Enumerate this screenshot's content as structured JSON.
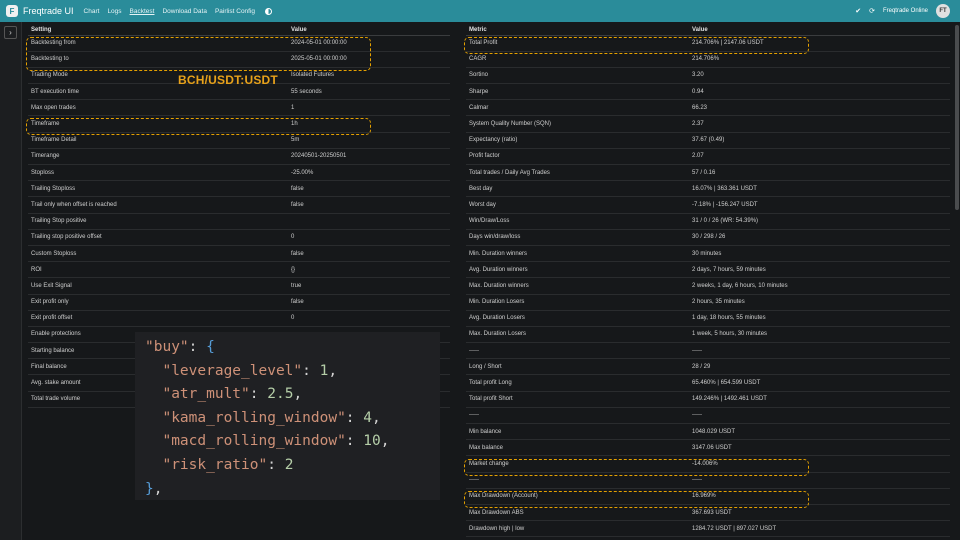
{
  "navbar": {
    "brand": "Freqtrade UI",
    "links": [
      "Chart",
      "Logs",
      "Backtest",
      "Download Data",
      "Pairlist Config"
    ],
    "active_link": "Backtest",
    "bot_status": "Freqtrade Online",
    "avatar": "FT"
  },
  "pair_label": "BCH/USDT:USDT",
  "settings_table": {
    "headers": [
      "Setting",
      "Value"
    ],
    "rows": [
      [
        "Backtesting from",
        "2024-05-01 00:00:00"
      ],
      [
        "Backtesting to",
        "2025-05-01 00:00:00"
      ],
      [
        "Trading Mode",
        "Isolated Futures"
      ],
      [
        "BT execution time",
        "55 seconds"
      ],
      [
        "Max open trades",
        "1"
      ],
      [
        "Timeframe",
        "1h"
      ],
      [
        "Timeframe Detail",
        "5m"
      ],
      [
        "Timerange",
        "20240501-20250501"
      ],
      [
        "Stoploss",
        "-25.00%"
      ],
      [
        "Trailing Stoploss",
        "false"
      ],
      [
        "Trail only when offset is reached",
        "false"
      ],
      [
        "Trailing Stop positive",
        ""
      ],
      [
        "Trailing stop positive offset",
        "0"
      ],
      [
        "Custom Stoploss",
        "false"
      ],
      [
        "ROI",
        "{}"
      ],
      [
        "Use Exit Signal",
        "true"
      ],
      [
        "Exit profit only",
        "false"
      ],
      [
        "Exit profit offset",
        "0"
      ],
      [
        "Enable protections",
        ""
      ],
      [
        "Starting balance",
        ""
      ],
      [
        "Final balance",
        ""
      ],
      [
        "Avg. stake amount",
        ""
      ],
      [
        "Total trade volume",
        ""
      ]
    ]
  },
  "metrics_table": {
    "headers": [
      "Metric",
      "Value"
    ],
    "rows": [
      [
        "Total Profit",
        "214.706% | 2147.06 USDT"
      ],
      [
        "CAGR",
        "214.706%"
      ],
      [
        "Sortino",
        "3.20"
      ],
      [
        "Sharpe",
        "0.94"
      ],
      [
        "Calmar",
        "66.23"
      ],
      [
        "System Quality Number (SQN)",
        "2.37"
      ],
      [
        "Expectancy (ratio)",
        "37.67 (0.49)"
      ],
      [
        "Profit factor",
        "2.07"
      ],
      [
        "Total trades / Daily Avg Trades",
        "57 / 0.16"
      ],
      [
        "Best day",
        "16.07% | 363.361 USDT"
      ],
      [
        "Worst day",
        "-7.18% | -156.247 USDT"
      ],
      [
        "Win/Draw/Loss",
        "31 / 0 / 26 (WR: 54.39%)"
      ],
      [
        "Days win/draw/loss",
        "30 / 298 / 26"
      ],
      [
        "Min. Duration winners",
        "30 minutes"
      ],
      [
        "Avg. Duration winners",
        "2 days, 7 hours, 59 minutes"
      ],
      [
        "Max. Duration winners",
        "2 weeks, 1 day, 6 hours, 10 minutes"
      ],
      [
        "Min. Duration Losers",
        "2 hours, 35 minutes"
      ],
      [
        "Avg. Duration Losers",
        "1 day, 18 hours, 55 minutes"
      ],
      [
        "Max. Duration Losers",
        "1 week, 5 hours, 30 minutes"
      ],
      [
        "-----",
        "-----"
      ],
      [
        "Long / Short",
        "28 / 29"
      ],
      [
        "Total profit Long",
        "65.460% | 654.599 USDT"
      ],
      [
        "Total profit Short",
        "149.246% | 1492.461 USDT"
      ],
      [
        "-----",
        "-----"
      ],
      [
        "Min balance",
        "1048.029 USDT"
      ],
      [
        "Max balance",
        "3147.06 USDT"
      ],
      [
        "Market change",
        "-14.006%"
      ],
      [
        "-----",
        "-----"
      ],
      [
        "Max Drawdown (Account)",
        "16.969%"
      ],
      [
        "Max Drawdown ABS",
        "367.693 USDT"
      ],
      [
        "Drawdown high | low",
        "1284.72 USDT | 897.027 USDT"
      ]
    ]
  },
  "code_overlay": {
    "key": "\"buy\"",
    "params": [
      {
        "name": "\"leverage_level\"",
        "value": "1"
      },
      {
        "name": "\"atr_mult\"",
        "value": "2.5"
      },
      {
        "name": "\"kama_rolling_window\"",
        "value": "4"
      },
      {
        "name": "\"macd_rolling_window\"",
        "value": "10"
      },
      {
        "name": "\"risk_ratio\"",
        "value": "2"
      }
    ]
  },
  "colors": {
    "navbar": "#2a8c9a",
    "highlight": "#e5a100",
    "background": "#16181a"
  }
}
